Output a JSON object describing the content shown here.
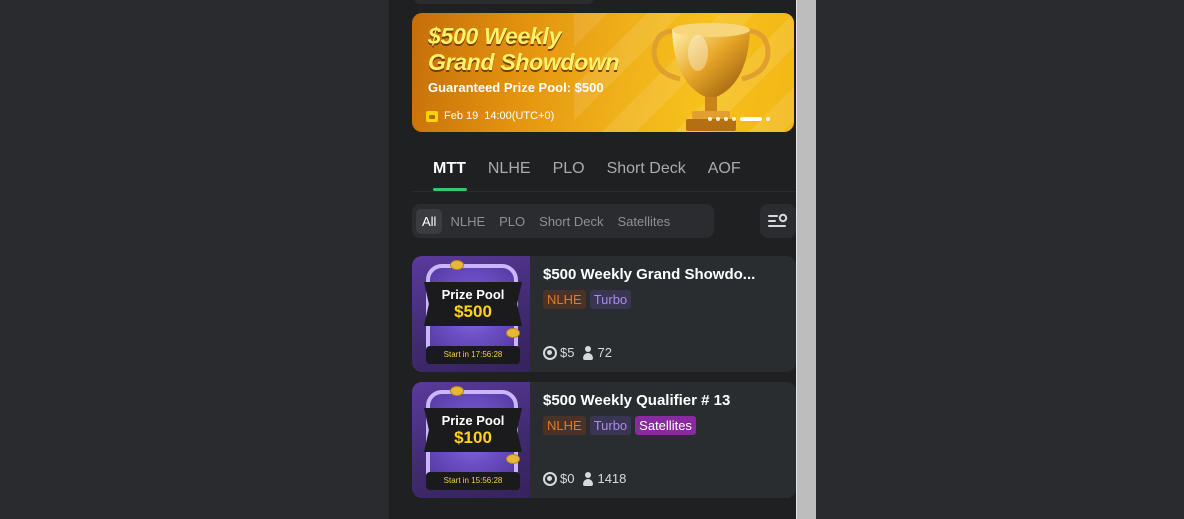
{
  "banner": {
    "title_line1": "$500 Weekly",
    "title_line2": "Grand Showdown",
    "subtitle": "Guaranteed Prize Pool: $500",
    "date": "Feb 19",
    "time": "14:00(UTC+0)"
  },
  "main_tabs": [
    "MTT",
    "NLHE",
    "PLO",
    "Short Deck",
    "AOF"
  ],
  "sub_filters": [
    "All",
    "NLHE",
    "PLO",
    "Short Deck",
    "Satellites"
  ],
  "tournaments": [
    {
      "title": "$500 Weekly Grand Showdo...",
      "prize_label": "Prize Pool",
      "prize_amount": "$500",
      "start_text": "Start in 17:56:28",
      "tags": [
        "NLHE",
        "Turbo"
      ],
      "buy_in": "$5",
      "players": "72"
    },
    {
      "title": "$500 Weekly Qualifier # 13",
      "prize_label": "Prize Pool",
      "prize_amount": "$100",
      "start_text": "Start in 15:56:28",
      "tags": [
        "NLHE",
        "Turbo",
        "Satellites"
      ],
      "buy_in": "$0",
      "players": "1418"
    }
  ],
  "colors": {
    "accent_green": "#37c76a",
    "banner_gold": "#f0b11a",
    "tag_nlhe": "#e07a2a",
    "tag_turbo": "#a98ce8",
    "tag_satellites": "#8a2aa0"
  }
}
